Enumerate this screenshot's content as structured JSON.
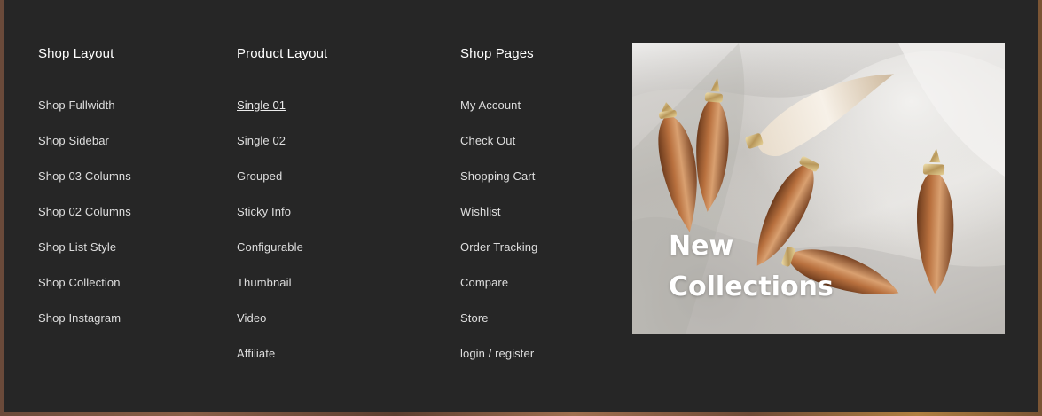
{
  "columns": [
    {
      "title": "Shop Layout",
      "links": [
        "Shop Fullwidth",
        "Shop Sidebar",
        "Shop 03 Columns",
        "Shop 02 Columns",
        "Shop List Style",
        "Shop Collection",
        "Shop Instagram"
      ]
    },
    {
      "title": "Product Layout",
      "links": [
        "Single 01",
        "Single 02",
        "Grouped",
        "Sticky Info",
        "Configurable",
        "Thumbnail",
        "Video",
        "Affiliate"
      ]
    },
    {
      "title": "Shop Pages",
      "links": [
        "My Account",
        "Check Out",
        "Shopping Cart",
        "Wishlist",
        "Order Tracking",
        "Compare",
        "Store",
        "login / register"
      ]
    }
  ],
  "banner": {
    "line1": "New",
    "line2": "Collections",
    "image": "seashells-on-silk-image"
  },
  "colors": {
    "panel_bg": "#262626",
    "title_text": "#ffffff",
    "link_text": "#dedede",
    "underline": "#8a8a8a"
  }
}
